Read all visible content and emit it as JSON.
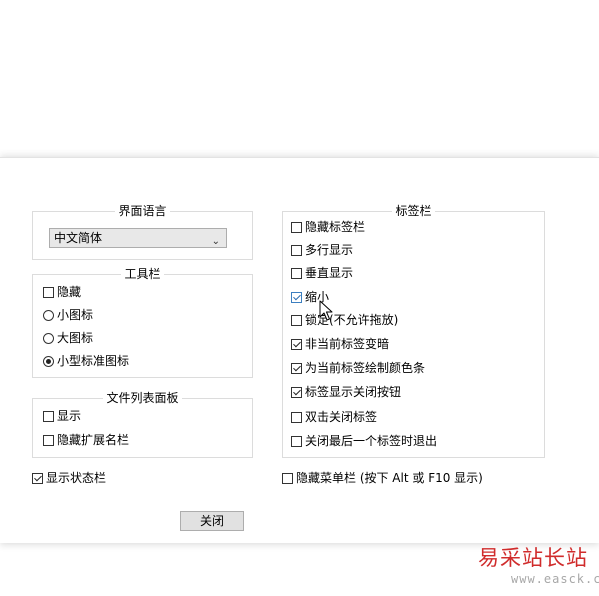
{
  "language_group": {
    "title": "界面语言",
    "selected": "中文简体"
  },
  "toolbar_group": {
    "title": "工具栏",
    "hide_label": "隐藏",
    "hide_checked": false,
    "options": [
      {
        "label": "小图标",
        "selected": false
      },
      {
        "label": "大图标",
        "selected": false
      },
      {
        "label": "小型标准图标",
        "selected": true
      }
    ]
  },
  "file_list_group": {
    "title": "文件列表面板",
    "items": [
      {
        "label": "显示",
        "checked": false
      },
      {
        "label": "隐藏扩展名栏",
        "checked": false
      }
    ]
  },
  "status_bar": {
    "label": "显示状态栏",
    "checked": true
  },
  "tab_bar_group": {
    "title": "标签栏",
    "items": [
      {
        "label": "隐藏标签栏",
        "checked": false
      },
      {
        "label": "多行显示",
        "checked": false
      },
      {
        "label": "垂直显示",
        "checked": false
      },
      {
        "label": "缩小",
        "checked": true
      },
      {
        "label": "锁定(不允许拖放)",
        "checked": false
      },
      {
        "label": "非当前标签变暗",
        "checked": true
      },
      {
        "label": "为当前标签绘制颜色条",
        "checked": true
      },
      {
        "label": "标签显示关闭按钮",
        "checked": true
      },
      {
        "label": "双击关闭标签",
        "checked": false
      },
      {
        "label": "关闭最后一个标签时退出",
        "checked": false
      }
    ]
  },
  "hide_menu_bar": {
    "label": "隐藏菜单栏 (按下 Alt 或 F10 显示)",
    "checked": false
  },
  "close_button": {
    "label": "关闭"
  },
  "watermark": {
    "text": "易采站长站",
    "url": "www.easck.com"
  }
}
